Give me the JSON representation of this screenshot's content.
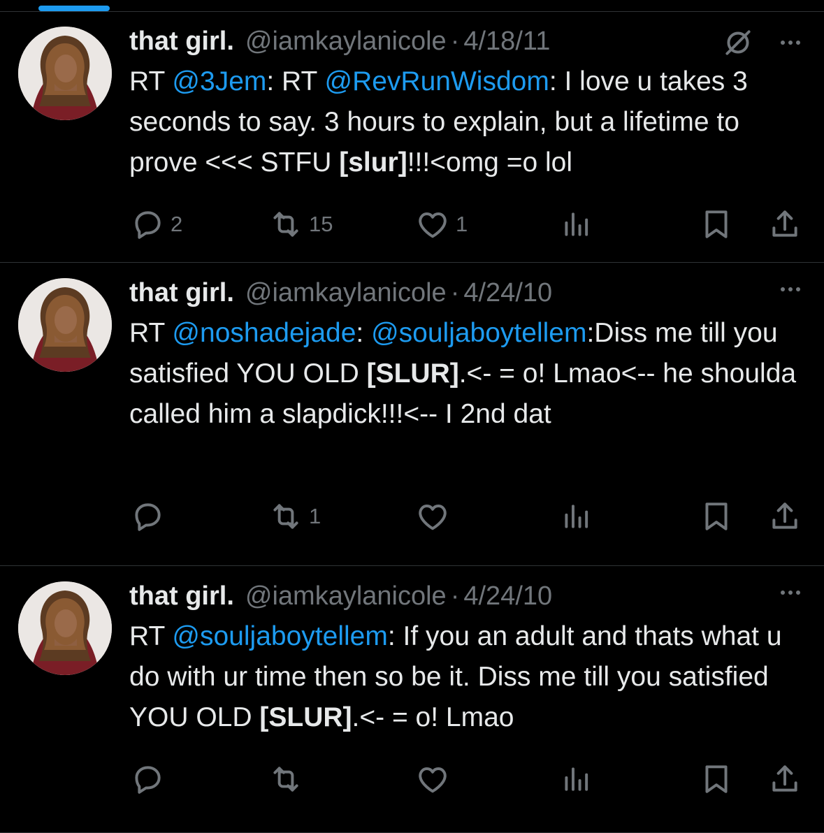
{
  "colors": {
    "background": "#000000",
    "text": "#e7e9ea",
    "muted": "#71767b",
    "link": "#1d9bf0",
    "divider": "#2f3336"
  },
  "tweets": [
    {
      "name": "that girl.",
      "handle": "@iamkaylanicole",
      "separator": "·",
      "date": "4/18/11",
      "show_noaudio_icon": true,
      "body": [
        {
          "text": "RT ",
          "type": "text"
        },
        {
          "text": "@3Jem",
          "type": "mention"
        },
        {
          "text": ": RT ",
          "type": "text"
        },
        {
          "text": "@RevRunWisdom",
          "type": "mention"
        },
        {
          "text": ": I love u takes 3 seconds to say. 3 hours to explain, but a lifetime to prove <<< STFU ",
          "type": "text"
        },
        {
          "text": "[slur]",
          "type": "bold"
        },
        {
          "text": "!!!<omg =o lol",
          "type": "text"
        }
      ],
      "actions": {
        "replies": "2",
        "reposts": "15",
        "likes": "1",
        "views": "",
        "reply_icon": "reply-icon",
        "repost_icon": "repost-icon",
        "like_icon": "heart-icon",
        "views_icon": "views-icon",
        "bookmark_icon": "bookmark-icon",
        "share_icon": "share-icon"
      }
    },
    {
      "name": "that girl.",
      "handle": "@iamkaylanicole",
      "separator": "·",
      "date": "4/24/10",
      "show_noaudio_icon": false,
      "body": [
        {
          "text": "RT ",
          "type": "text"
        },
        {
          "text": "@noshadejade",
          "type": "mention"
        },
        {
          "text": ": ",
          "type": "text"
        },
        {
          "text": "@souljaboytellem",
          "type": "mention"
        },
        {
          "text": ":Diss me till you satisfied YOU OLD ",
          "type": "text"
        },
        {
          "text": "[SLUR]",
          "type": "bold"
        },
        {
          "text": ".<- = o! Lmao<-- he shoulda called him a slapdick!!!<-- I 2nd dat",
          "type": "text"
        }
      ],
      "actions": {
        "replies": "",
        "reposts": "1",
        "likes": "",
        "views": ""
      }
    },
    {
      "name": "that girl.",
      "handle": "@iamkaylanicole",
      "separator": "·",
      "date": "4/24/10",
      "show_noaudio_icon": false,
      "body": [
        {
          "text": "RT ",
          "type": "text"
        },
        {
          "text": "@souljaboytellem",
          "type": "mention"
        },
        {
          "text": ": If you an adult and thats what u do with ur time then so be it. Diss me till you satisfied YOU OLD ",
          "type": "text"
        },
        {
          "text": "[SLUR]",
          "type": "bold"
        },
        {
          "text": ".<- = o! Lmao",
          "type": "text"
        }
      ],
      "actions": {
        "replies": "",
        "reposts": "",
        "likes": "",
        "views": ""
      }
    }
  ]
}
